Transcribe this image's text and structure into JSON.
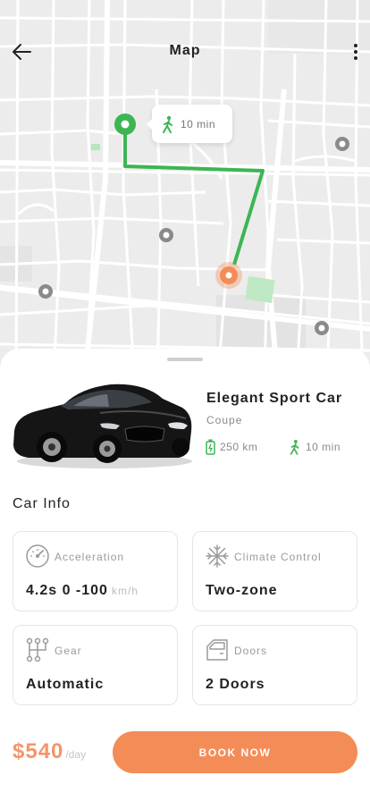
{
  "header": {
    "title": "Map"
  },
  "map": {
    "walk_time": "10 min"
  },
  "car": {
    "name": "Elegant Sport Car",
    "type": "Coupe",
    "range": "250 km",
    "walk_time": "10 min"
  },
  "car_info": {
    "title": "Car Info",
    "cards": [
      {
        "label": "Acceleration",
        "value": "4.2s 0 -100",
        "unit": "km/h",
        "icon": "speedometer-icon"
      },
      {
        "label": "Climate Control",
        "value": "Two-zone",
        "icon": "snowflake-icon"
      },
      {
        "label": "Gear",
        "value": "Automatic",
        "icon": "gearbox-icon"
      },
      {
        "label": "Doors",
        "value": "2 Doors",
        "icon": "car-door-icon"
      }
    ]
  },
  "footer": {
    "price": "$540",
    "per": "/day",
    "book_label": "BOOK NOW"
  },
  "colors": {
    "accent": "#f48c58",
    "route": "#3db553",
    "map_bg": "#ececec"
  }
}
